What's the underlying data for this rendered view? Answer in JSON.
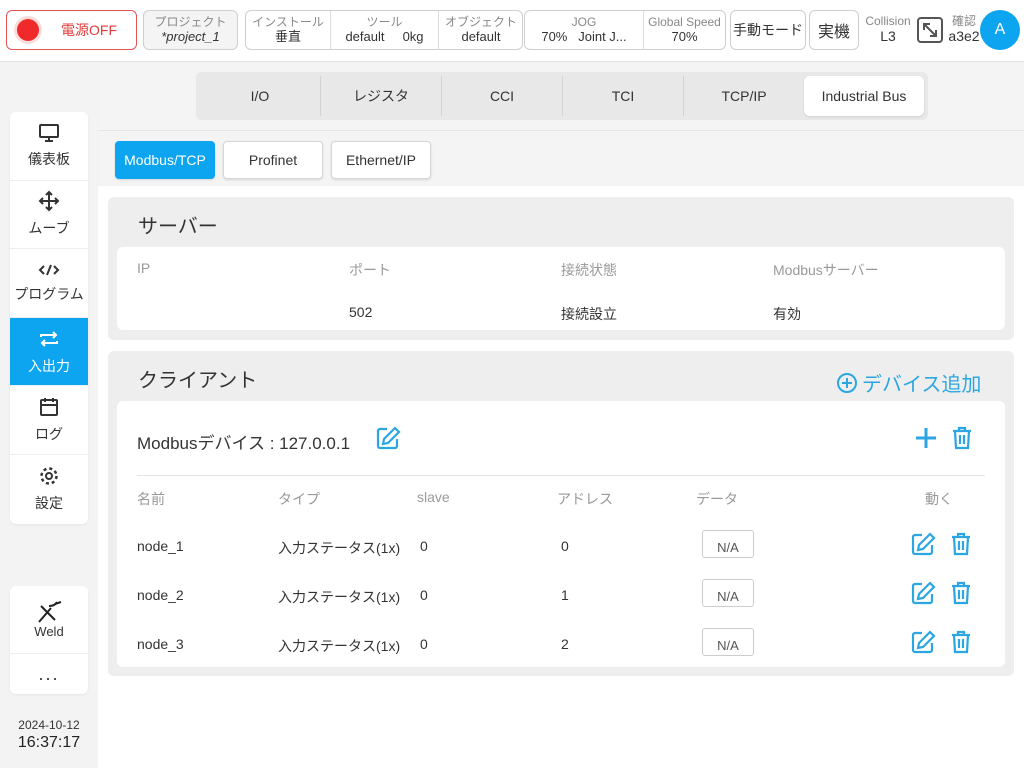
{
  "topbar": {
    "power_label": "電源OFF",
    "project_label": "プロジェクト",
    "project_value": "*project_1",
    "install_label": "インストール",
    "install_value": "垂直",
    "tool_label": "ツール",
    "tool_value": "default",
    "tool_weight": "0kg",
    "object_label": "オブジェクト",
    "object_value": "default",
    "jog_label": "JOG",
    "jog_speed": "70%",
    "jog_mode": "Joint J...",
    "global_speed_label": "Global Speed",
    "global_speed_value": "70%",
    "manual_mode": "手動モード",
    "real_mode": "実機",
    "collision_label": "Collision",
    "collision_value": "L3",
    "confirm_label": "確認",
    "confirm_value": "a3e2",
    "avatar": "A"
  },
  "sidebar": {
    "items": [
      {
        "label": "儀表板",
        "icon": "monitor-icon"
      },
      {
        "label": "ムーブ",
        "icon": "move-icon"
      },
      {
        "label": "プログラム",
        "icon": "code-icon"
      },
      {
        "label": "入出力",
        "icon": "exchange-icon"
      },
      {
        "label": "ログ",
        "icon": "calendar-icon"
      },
      {
        "label": "設定",
        "icon": "gear-icon"
      }
    ],
    "weld_label": "Weld",
    "more_label": "...",
    "date": "2024-10-12",
    "time": "16:37:17"
  },
  "tabs": [
    "I/O",
    "レジスタ",
    "CCI",
    "TCI",
    "TCP/IP",
    "Industrial Bus"
  ],
  "subtabs": [
    "Modbus/TCP",
    "Profinet",
    "Ethernet/IP"
  ],
  "server": {
    "title": "サーバー",
    "headers": [
      "IP",
      "ポート",
      "接続状態",
      "Modbusサーバー"
    ],
    "row": [
      "",
      "502",
      "接続設立",
      "有効"
    ]
  },
  "client": {
    "title": "クライアント",
    "add_device": "デバイス追加",
    "device_title": "Modbusデバイス : 127.0.0.1",
    "headers": [
      "名前",
      "タイプ",
      "slave",
      "アドレス",
      "データ",
      "動く"
    ],
    "rows": [
      {
        "name": "node_1",
        "type": "入力ステータス(1x)",
        "slave": "0",
        "address": "0",
        "data": "N/A"
      },
      {
        "name": "node_2",
        "type": "入力ステータス(1x)",
        "slave": "0",
        "address": "1",
        "data": "N/A"
      },
      {
        "name": "node_3",
        "type": "入力ステータス(1x)",
        "slave": "0",
        "address": "2",
        "data": "N/A"
      }
    ]
  },
  "colors": {
    "accent": "#0ea5f0",
    "power": "#f02a2a",
    "link": "#2ba6e3"
  }
}
